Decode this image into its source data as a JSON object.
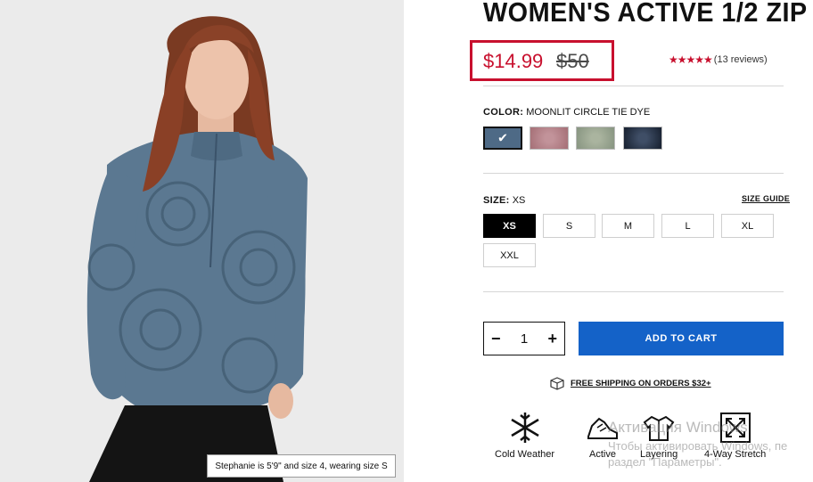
{
  "product": {
    "title": "WOMEN'S ACTIVE 1/2 ZIP",
    "sale_price": "$14.99",
    "original_price": "$50",
    "stars": "★★★★★",
    "reviews": "(13 reviews)"
  },
  "model_caption": "Stephanie is 5'9\" and size 4, wearing size S",
  "color": {
    "label": "COLOR:",
    "value": "MOONLIT CIRCLE TIE DYE",
    "check": "✔",
    "swatches": [
      {
        "color": "#4e6a86",
        "selected": true
      },
      {
        "color": "#b47f86"
      },
      {
        "color": "#98a58f"
      },
      {
        "color": "#253248"
      }
    ]
  },
  "size": {
    "label": "SIZE:",
    "value": "XS",
    "guide_label": "SIZE GUIDE",
    "options": [
      "XS",
      "S",
      "M",
      "L",
      "XL",
      "XXL"
    ],
    "selected": "XS"
  },
  "cart": {
    "quantity": "1",
    "minus": "−",
    "plus": "+",
    "add_label": "ADD TO CART"
  },
  "shipping_label": "FREE SHIPPING ON ORDERS $32+",
  "features": [
    "Cold Weather",
    "Active",
    "Layering",
    "4-Way Stretch"
  ],
  "watermark": {
    "line1": "Активация Windows",
    "line2": "Чтобы активировать Windows, пе",
    "line3": "раздел \"Параметры\"."
  },
  "colors": {
    "accent_red": "#c8102e",
    "cart_blue": "#1462c8"
  }
}
